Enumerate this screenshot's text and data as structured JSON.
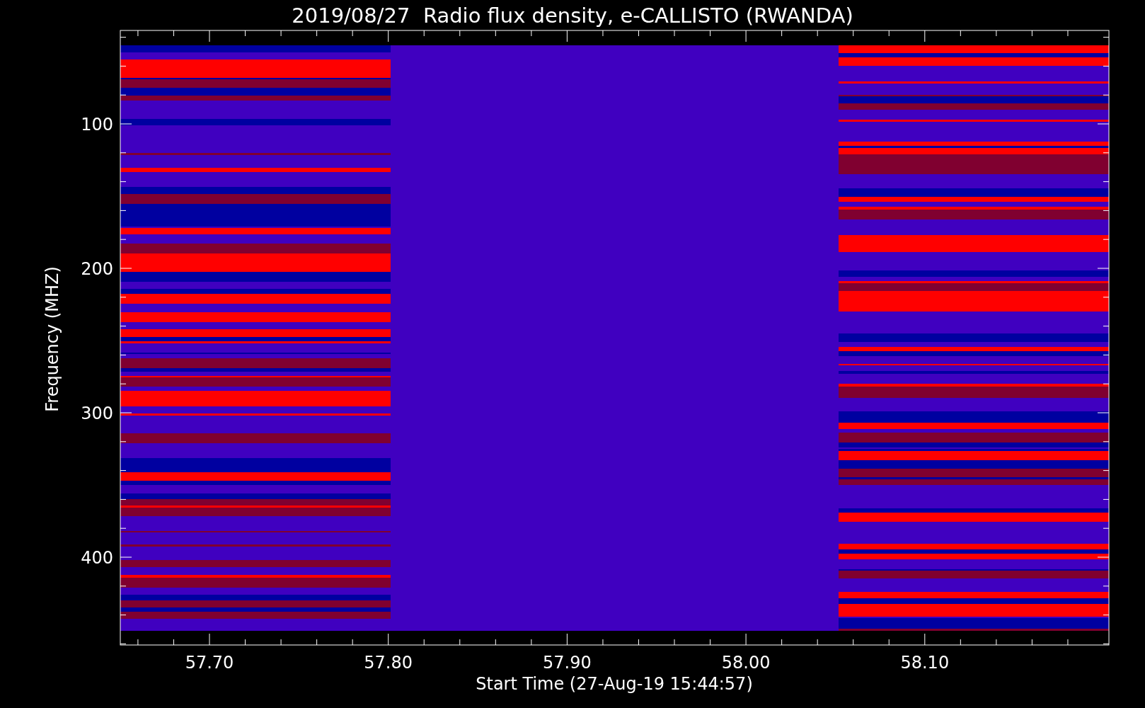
{
  "title": "2019/08/27  Radio flux density, e-CALLISTO (RWANDA)",
  "y_axis": {
    "label": "Frequency (MHZ)",
    "ticks": [
      "100",
      "200",
      "300",
      "400"
    ]
  },
  "x_axis": {
    "label": "Start Time (27-Aug-19 15:44:57)",
    "ticks": [
      "57.70",
      "57.80",
      "57.90",
      "58.00",
      "58.10"
    ]
  }
}
